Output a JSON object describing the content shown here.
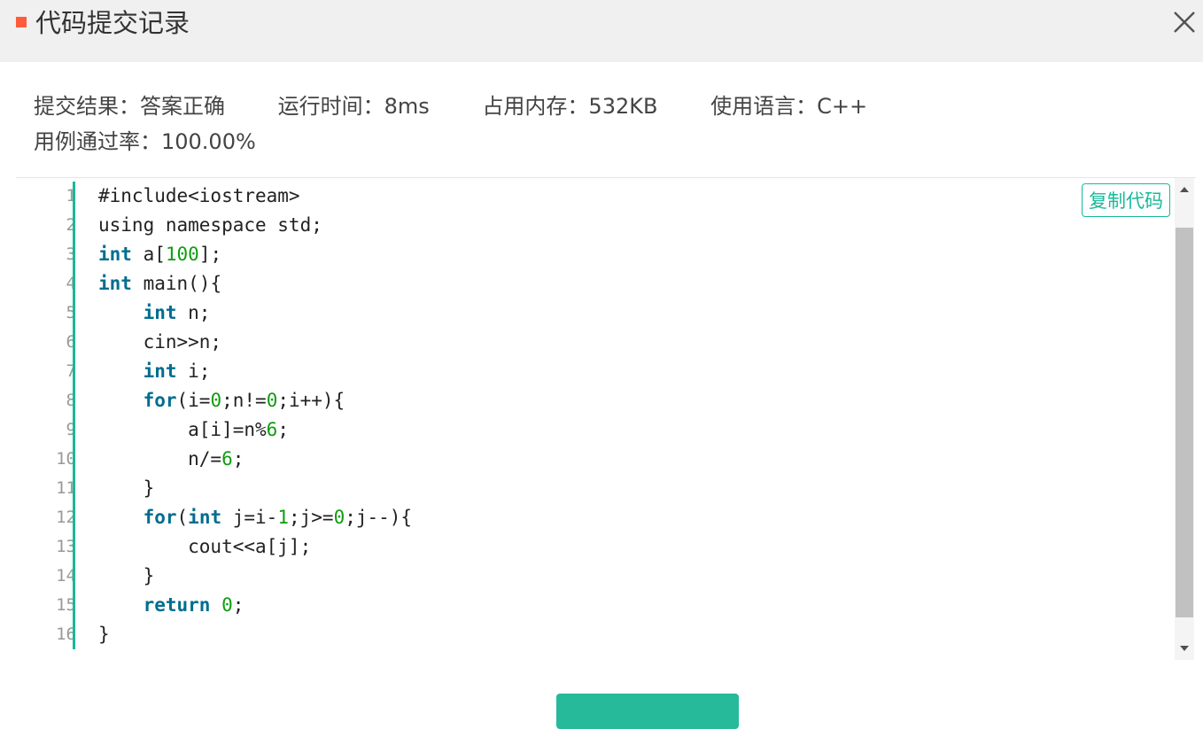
{
  "header": {
    "title": "代码提交记录",
    "marker_color": "#ff5b3a",
    "close_icon": "close-icon"
  },
  "info": {
    "result": "提交结果：答案正确",
    "runtime": "运行时间：8ms",
    "memory": "占用内存：532KB",
    "language": "使用语言：C++",
    "pass_rate": "用例通过率：100.00%"
  },
  "code": {
    "copy_label": "复制代码",
    "line_numbers": [
      "1",
      "2",
      "3",
      "4",
      "5",
      "6",
      "7",
      "8",
      "9",
      "10",
      "11",
      "12",
      "13",
      "14",
      "15",
      "16"
    ],
    "lines": [
      "#include<iostream>",
      "using namespace std;",
      "int a[100];",
      "int main(){",
      "    int n;",
      "    cin>>n;",
      "    int i;",
      "    for(i=0;n!=0;i++){",
      "        a[i]=n%6;",
      "        n/=6;",
      "    }",
      "    for(int j=i-1;j>=0;j--){",
      "        cout<<a[j];",
      "    }",
      "    return 0;",
      "}"
    ]
  },
  "colors": {
    "accent": "#19b99a",
    "keyword": "#006d8f",
    "number": "#0f9d0f"
  }
}
